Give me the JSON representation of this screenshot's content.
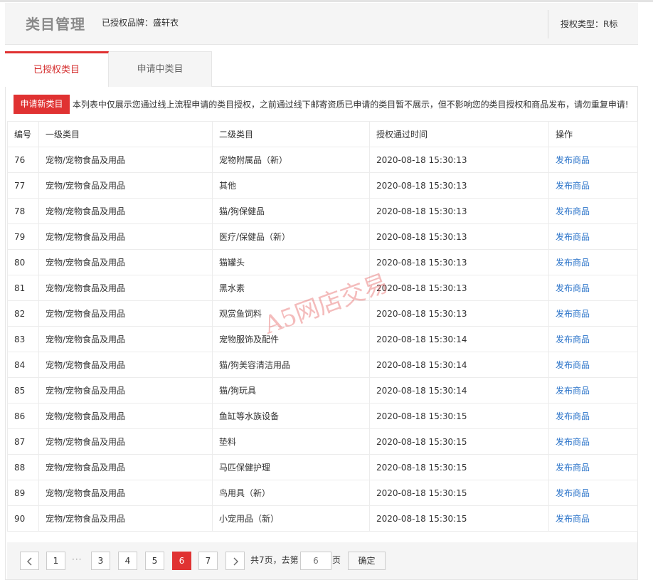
{
  "header": {
    "title": "类目管理",
    "brand": "已授权品牌：盛轩衣",
    "auth_type": "授权类型：R标"
  },
  "tabs": [
    {
      "label": "已授权类目",
      "active": true
    },
    {
      "label": "申请中类目",
      "active": false
    }
  ],
  "apply_button": "申请新类目",
  "notice": "本列表中仅展示您通过线上流程申请的类目授权，之前通过线下邮寄资质已申请的类目暂不展示，但不影响您的类目授权和商品发布，请勿重复申请!",
  "table": {
    "columns": [
      "编号",
      "一级类目",
      "二级类目",
      "授权通过时间",
      "操作"
    ],
    "rows": [
      [
        "76",
        "宠物/宠物食品及用品",
        "宠物附属品（新）",
        "2020-08-18 15:30:13",
        "发布商品"
      ],
      [
        "77",
        "宠物/宠物食品及用品",
        "其他",
        "2020-08-18 15:30:13",
        "发布商品"
      ],
      [
        "78",
        "宠物/宠物食品及用品",
        "猫/狗保健品",
        "2020-08-18 15:30:13",
        "发布商品"
      ],
      [
        "79",
        "宠物/宠物食品及用品",
        "医疗/保健品（新）",
        "2020-08-18 15:30:13",
        "发布商品"
      ],
      [
        "80",
        "宠物/宠物食品及用品",
        "猫罐头",
        "2020-08-18 15:30:13",
        "发布商品"
      ],
      [
        "81",
        "宠物/宠物食品及用品",
        "黑水素",
        "2020-08-18 15:30:13",
        "发布商品"
      ],
      [
        "82",
        "宠物/宠物食品及用品",
        "观赏鱼饲料",
        "2020-08-18 15:30:13",
        "发布商品"
      ],
      [
        "83",
        "宠物/宠物食品及用品",
        "宠物服饰及配件",
        "2020-08-18 15:30:14",
        "发布商品"
      ],
      [
        "84",
        "宠物/宠物食品及用品",
        "猫/狗美容清洁用品",
        "2020-08-18 15:30:14",
        "发布商品"
      ],
      [
        "85",
        "宠物/宠物食品及用品",
        "猫/狗玩具",
        "2020-08-18 15:30:14",
        "发布商品"
      ],
      [
        "86",
        "宠物/宠物食品及用品",
        "鱼缸等水族设备",
        "2020-08-18 15:30:15",
        "发布商品"
      ],
      [
        "87",
        "宠物/宠物食品及用品",
        "垫料",
        "2020-08-18 15:30:15",
        "发布商品"
      ],
      [
        "88",
        "宠物/宠物食品及用品",
        "马匹保健护理",
        "2020-08-18 15:30:15",
        "发布商品"
      ],
      [
        "89",
        "宠物/宠物食品及用品",
        "鸟用具（新）",
        "2020-08-18 15:30:15",
        "发布商品"
      ],
      [
        "90",
        "宠物/宠物食品及用品",
        "小宠用品（新）",
        "2020-08-18 15:30:15",
        "发布商品"
      ]
    ]
  },
  "pagination": {
    "prev_icon": "chevron-left-icon",
    "next_icon": "chevron-right-icon",
    "pages": [
      "1",
      "3",
      "4",
      "5",
      "6",
      "7"
    ],
    "current": "6",
    "ellipsis": "···",
    "total_text": "共7页，去第",
    "page_input_placeholder": "6",
    "page_suffix": "页",
    "confirm": "确定"
  },
  "watermark": "A5网店交易",
  "colors": {
    "accent": "#e03232",
    "link": "#2a73c9"
  }
}
